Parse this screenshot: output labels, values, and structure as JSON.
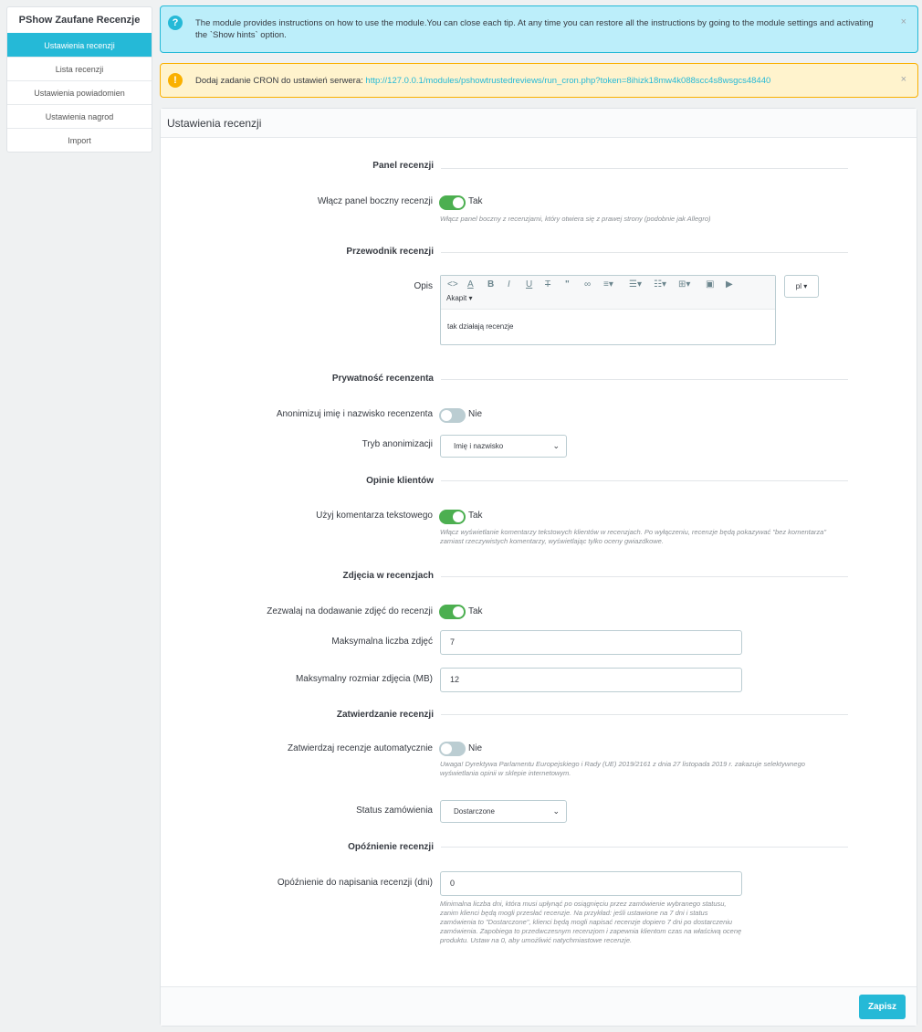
{
  "sidebar": {
    "title": "PShow Zaufane Recenzje",
    "items": [
      {
        "label": "Ustawienia recenzji"
      },
      {
        "label": "Lista recenzji"
      },
      {
        "label": "Ustawienia powiadomien"
      },
      {
        "label": "Ustawienia nagrod"
      },
      {
        "label": "Import"
      }
    ]
  },
  "alerts": {
    "info": {
      "text": "The module provides instructions on how to use the module.You can close each tip. At any time you can restore all the instructions by going to the module settings and activating the `Show hints` option.",
      "close": "×"
    },
    "warning": {
      "prefix": "Dodaj zadanie CRON do ustawień serwera: ",
      "link": "http://127.0.0.1/modules/pshowtrustedreviews/run_cron.php?token=8ihizk18mw4k088scc4s8wsgcs48440",
      "close": "×"
    }
  },
  "panel": {
    "title": "Ustawienia recenzji",
    "save_label": "Zapisz"
  },
  "sections": {
    "panel": "Panel recenzji",
    "guide": "Przewodnik recenzji",
    "privacy": "Prywatność recenzenta",
    "opinions": "Opinie klientów",
    "photos": "Zdjęcia w recenzjach",
    "approval": "Zatwierdzanie recenzji",
    "delay": "Opóźnienie recenzji"
  },
  "fields": {
    "side_panel": {
      "label": "Włącz panel boczny recenzji",
      "value": "Tak",
      "on": true,
      "help": "Włącz panel boczny z recenzjami, który otwiera się z prawej strony (podobnie jak Allegro)"
    },
    "description": {
      "label": "Opis",
      "paragraph": "Akapit ▾",
      "content": "tak działają recenzje",
      "lang": "pl ▾"
    },
    "anonymize": {
      "label": "Anonimizuj imię i nazwisko recenzenta",
      "value": "Nie",
      "on": false
    },
    "anon_mode": {
      "label": "Tryb anonimizacji",
      "value": "Imię i nazwisko"
    },
    "text_comment": {
      "label": "Użyj komentarza tekstowego",
      "value": "Tak",
      "on": true,
      "help": "Włącz wyświetlanie komentarzy tekstowych klientów w recenzjach. Po wyłączeniu, recenzje będą pokazywać \"bez komentarza\" zamiast rzeczywistych komentarzy, wyświetlając tylko oceny gwiazdkowe."
    },
    "allow_photos": {
      "label": "Zezwalaj na dodawanie zdjęć do recenzji",
      "value": "Tak",
      "on": true
    },
    "max_photos": {
      "label": "Maksymalna liczba zdjęć",
      "value": "7"
    },
    "max_photo_size": {
      "label": "Maksymalny rozmiar zdjęcia (MB)",
      "value": "12"
    },
    "auto_approve": {
      "label": "Zatwierdzaj recenzje automatycznie",
      "value": "Nie",
      "on": false,
      "help": "Uwaga! Dyrektywa Parlamentu Europejskiego i Rady (UE) 2019/2161 z dnia 27 listopada 2019 r. zakazuje selektywnego wyświetlania opinii w sklepie internetowym."
    },
    "order_status": {
      "label": "Status zamówienia",
      "value": "Dostarczone"
    },
    "review_delay": {
      "label": "Opóźnienie do napisania recenzji (dni)",
      "value": "0",
      "help": "Minimalna liczba dni, która musi upłynąć po osiągnięciu przez zamówienie wybranego statusu, zanim klienci będą mogli przesłać recenzje. Na przykład: jeśli ustawione na 7 dni i status zamówienia to \"Dostarczone\", klienci będą mogli napisać recenzje dopiero 7 dni po dostarczeniu zamówienia. Zapobiega to przedwczesnym recenzjom i zapewnia klientom czas na właściwą ocenę produktu. Ustaw na 0, aby umożliwić natychmiastowe recenzje."
    }
  },
  "icons": {
    "info": "question-circle-icon",
    "warning": "exclamation-circle-icon"
  },
  "colors": {
    "accent": "#25b9d7",
    "toggle_on": "#4caf50",
    "toggle_off": "#bbcdd2",
    "warning": "#fab000"
  }
}
